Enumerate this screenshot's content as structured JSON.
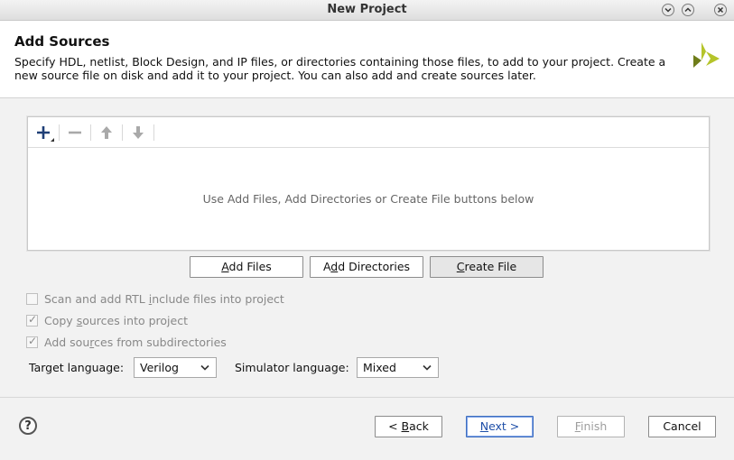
{
  "window": {
    "title": "New Project"
  },
  "header": {
    "title": "Add Sources",
    "description": "Specify HDL, netlist, Block Design, and IP files, or directories containing those files, to add to your project. Create a new source file on disk and add it to your project. You can also add and create sources later."
  },
  "toolbar": {
    "add_icon": "plus-icon",
    "remove_icon": "minus-icon",
    "up_icon": "arrow-up-icon",
    "down_icon": "arrow-down-icon"
  },
  "file_list": {
    "empty_message": "Use Add Files, Add Directories or Create File buttons below"
  },
  "buttons": {
    "add_files": {
      "pre": "",
      "key": "A",
      "post": "dd Files"
    },
    "add_directories": {
      "pre": "A",
      "key": "d",
      "post": "d Directories"
    },
    "create_file": {
      "pre": "",
      "key": "C",
      "post": "reate File"
    }
  },
  "options": {
    "scan_rtl": {
      "pre": "Scan and add RTL ",
      "key": "i",
      "post": "nclude files into project",
      "checked": false
    },
    "copy_sources": {
      "pre": "Copy ",
      "key": "s",
      "post": "ources into project",
      "checked": true
    },
    "add_subdirs": {
      "pre": "Add sou",
      "key": "r",
      "post": "ces from subdirectories",
      "checked": true
    }
  },
  "language": {
    "target_label": "Target language:",
    "target_value": "Verilog",
    "simulator_label": "Simulator language:",
    "simulator_value": "Mixed"
  },
  "footer": {
    "back": {
      "pre": "< ",
      "key": "B",
      "post": "ack"
    },
    "next": {
      "pre": "",
      "key": "N",
      "post": "ext >"
    },
    "finish": {
      "pre": "",
      "key": "F",
      "post": "inish"
    },
    "cancel": "Cancel",
    "help": "?"
  },
  "colors": {
    "logo_light": "#b5c42a",
    "logo_dark": "#6f7d1a",
    "primary_border": "#3f6fc0"
  }
}
